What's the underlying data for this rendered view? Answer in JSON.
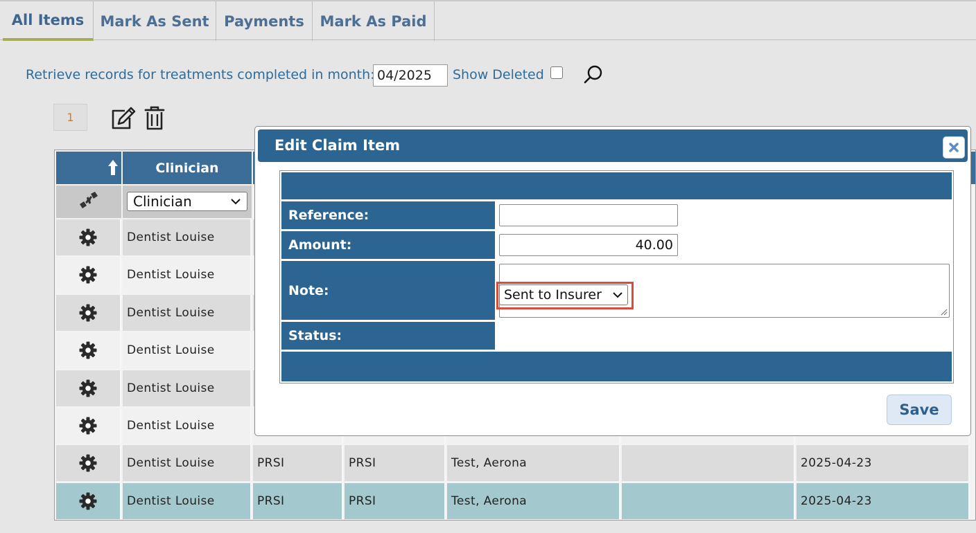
{
  "tabs": [
    {
      "label": "All Items",
      "active": true
    },
    {
      "label": "Mark As Sent",
      "active": false
    },
    {
      "label": "Payments",
      "active": false
    },
    {
      "label": "Mark As Paid",
      "active": false
    }
  ],
  "filter": {
    "label": "Retrieve records for treatments completed in month:",
    "month_value": "04/2025",
    "show_deleted_label": "Show Deleted",
    "show_deleted_checked": false
  },
  "pager": {
    "current_page": "1"
  },
  "grid": {
    "columns": [
      "Clinician"
    ],
    "clinician_filter_value": "Clinician",
    "rows": [
      {
        "clinician": "Dentist Louise",
        "col3": "",
        "col4": "",
        "patient": "",
        "col6": "",
        "date": ""
      },
      {
        "clinician": "Dentist Louise",
        "col3": "",
        "col4": "",
        "patient": "",
        "col6": "",
        "date": ""
      },
      {
        "clinician": "Dentist Louise",
        "col3": "",
        "col4": "",
        "patient": "",
        "col6": "",
        "date": ""
      },
      {
        "clinician": "Dentist Louise",
        "col3": "",
        "col4": "",
        "patient": "",
        "col6": "",
        "date": ""
      },
      {
        "clinician": "Dentist Louise",
        "col3": "",
        "col4": "",
        "patient": "",
        "col6": "",
        "date": ""
      },
      {
        "clinician": "Dentist Louise",
        "col3": "",
        "col4": "",
        "patient": "",
        "col6": "",
        "date": ""
      },
      {
        "clinician": "Dentist Louise",
        "col3": "PRSI",
        "col4": "PRSI",
        "patient": "Test, Aerona",
        "col6": "",
        "date": "2025-04-23"
      },
      {
        "clinician": "Dentist Louise",
        "col3": "PRSI",
        "col4": "PRSI",
        "patient": "Test, Aerona",
        "col6": "",
        "date": "2025-04-23"
      }
    ]
  },
  "dialog": {
    "title": "Edit Claim Item",
    "reference_label": "Reference:",
    "reference_value": "",
    "amount_label": "Amount:",
    "amount_value": "40.00",
    "note_label": "Note:",
    "note_value": "",
    "status_label": "Status:",
    "status_value": "Sent to Insurer",
    "save_label": "Save"
  },
  "colors": {
    "header_blue": "#3c6d98",
    "dialog_blue": "#2d6592",
    "tab_active_underline": "#a6ab57",
    "selected_row": "#a3c9cf",
    "highlight": "#d94b3a"
  }
}
